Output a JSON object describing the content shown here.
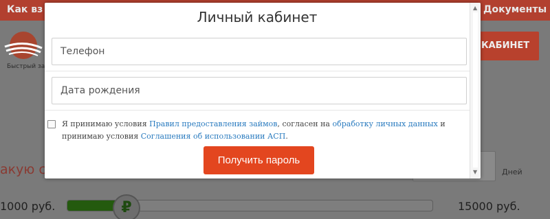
{
  "background": {
    "nav_left": "Как вз",
    "nav_right": "Документы",
    "logo_text": "Быстрый за",
    "cabinet_button": "КАБИНЕТ",
    "headline": "акую с",
    "days_label": "Дней",
    "min_amount": "1000 руб.",
    "max_amount": "15000 руб.",
    "slider_currency": "₽",
    "slider_value_fraction": 0.13
  },
  "modal": {
    "title": "Личный кабинет",
    "phone_placeholder": "Телефон",
    "dob_placeholder": "Дата рождения",
    "agree": {
      "t1": "Я принимаю условия ",
      "link1": "Правил предоставления займов",
      "t2": ", согласен на ",
      "link2": "обработку личных данных",
      "t3": " и принимаю условия ",
      "link3": "Соглашения об использовании АСП",
      "t4": "."
    },
    "submit_label": "Получить пароль"
  },
  "colors": {
    "accent": "#e3461f",
    "link": "#2a7bbf",
    "slider_fill": "#245a0e"
  }
}
